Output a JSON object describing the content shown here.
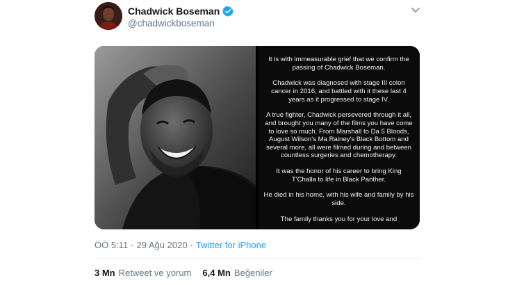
{
  "user": {
    "display_name": "Chadwick Boseman",
    "handle": "@chadwickboseman",
    "verified": true,
    "verified_color": "#1da1f2"
  },
  "media": {
    "statement_paragraphs": [
      "It is with immeasurable grief that we confirm the passing of Chadwick Boseman.",
      "Chadwick was diagnosed with stage III colon cancer in 2016, and battled with it these last 4 years as it progressed to stage IV.",
      "A true fighter, Chadwick persevered through it all, and brought you many of the films you have come to love so much. From Marshall to Da 5 Bloods, August Wilson's Ma Rainey's Black Bottom and several more, all were filmed during and between countless surgeries and chemotherapy.",
      "It was the honor of his career to bring King T'Challa to life in Black Panther.",
      "He died in his home, with his wife and family by his side.",
      "The family thanks you for your love and"
    ]
  },
  "meta": {
    "time": "ÖÖ 5:11",
    "separator": "·",
    "date": "29 Ağu 2020",
    "source": "Twitter for iPhone"
  },
  "stats": {
    "retweets_count": "3 Mn",
    "retweets_label": "Retweet ve yorum",
    "likes_count": "6,4 Mn",
    "likes_label": "Beğeniler"
  }
}
